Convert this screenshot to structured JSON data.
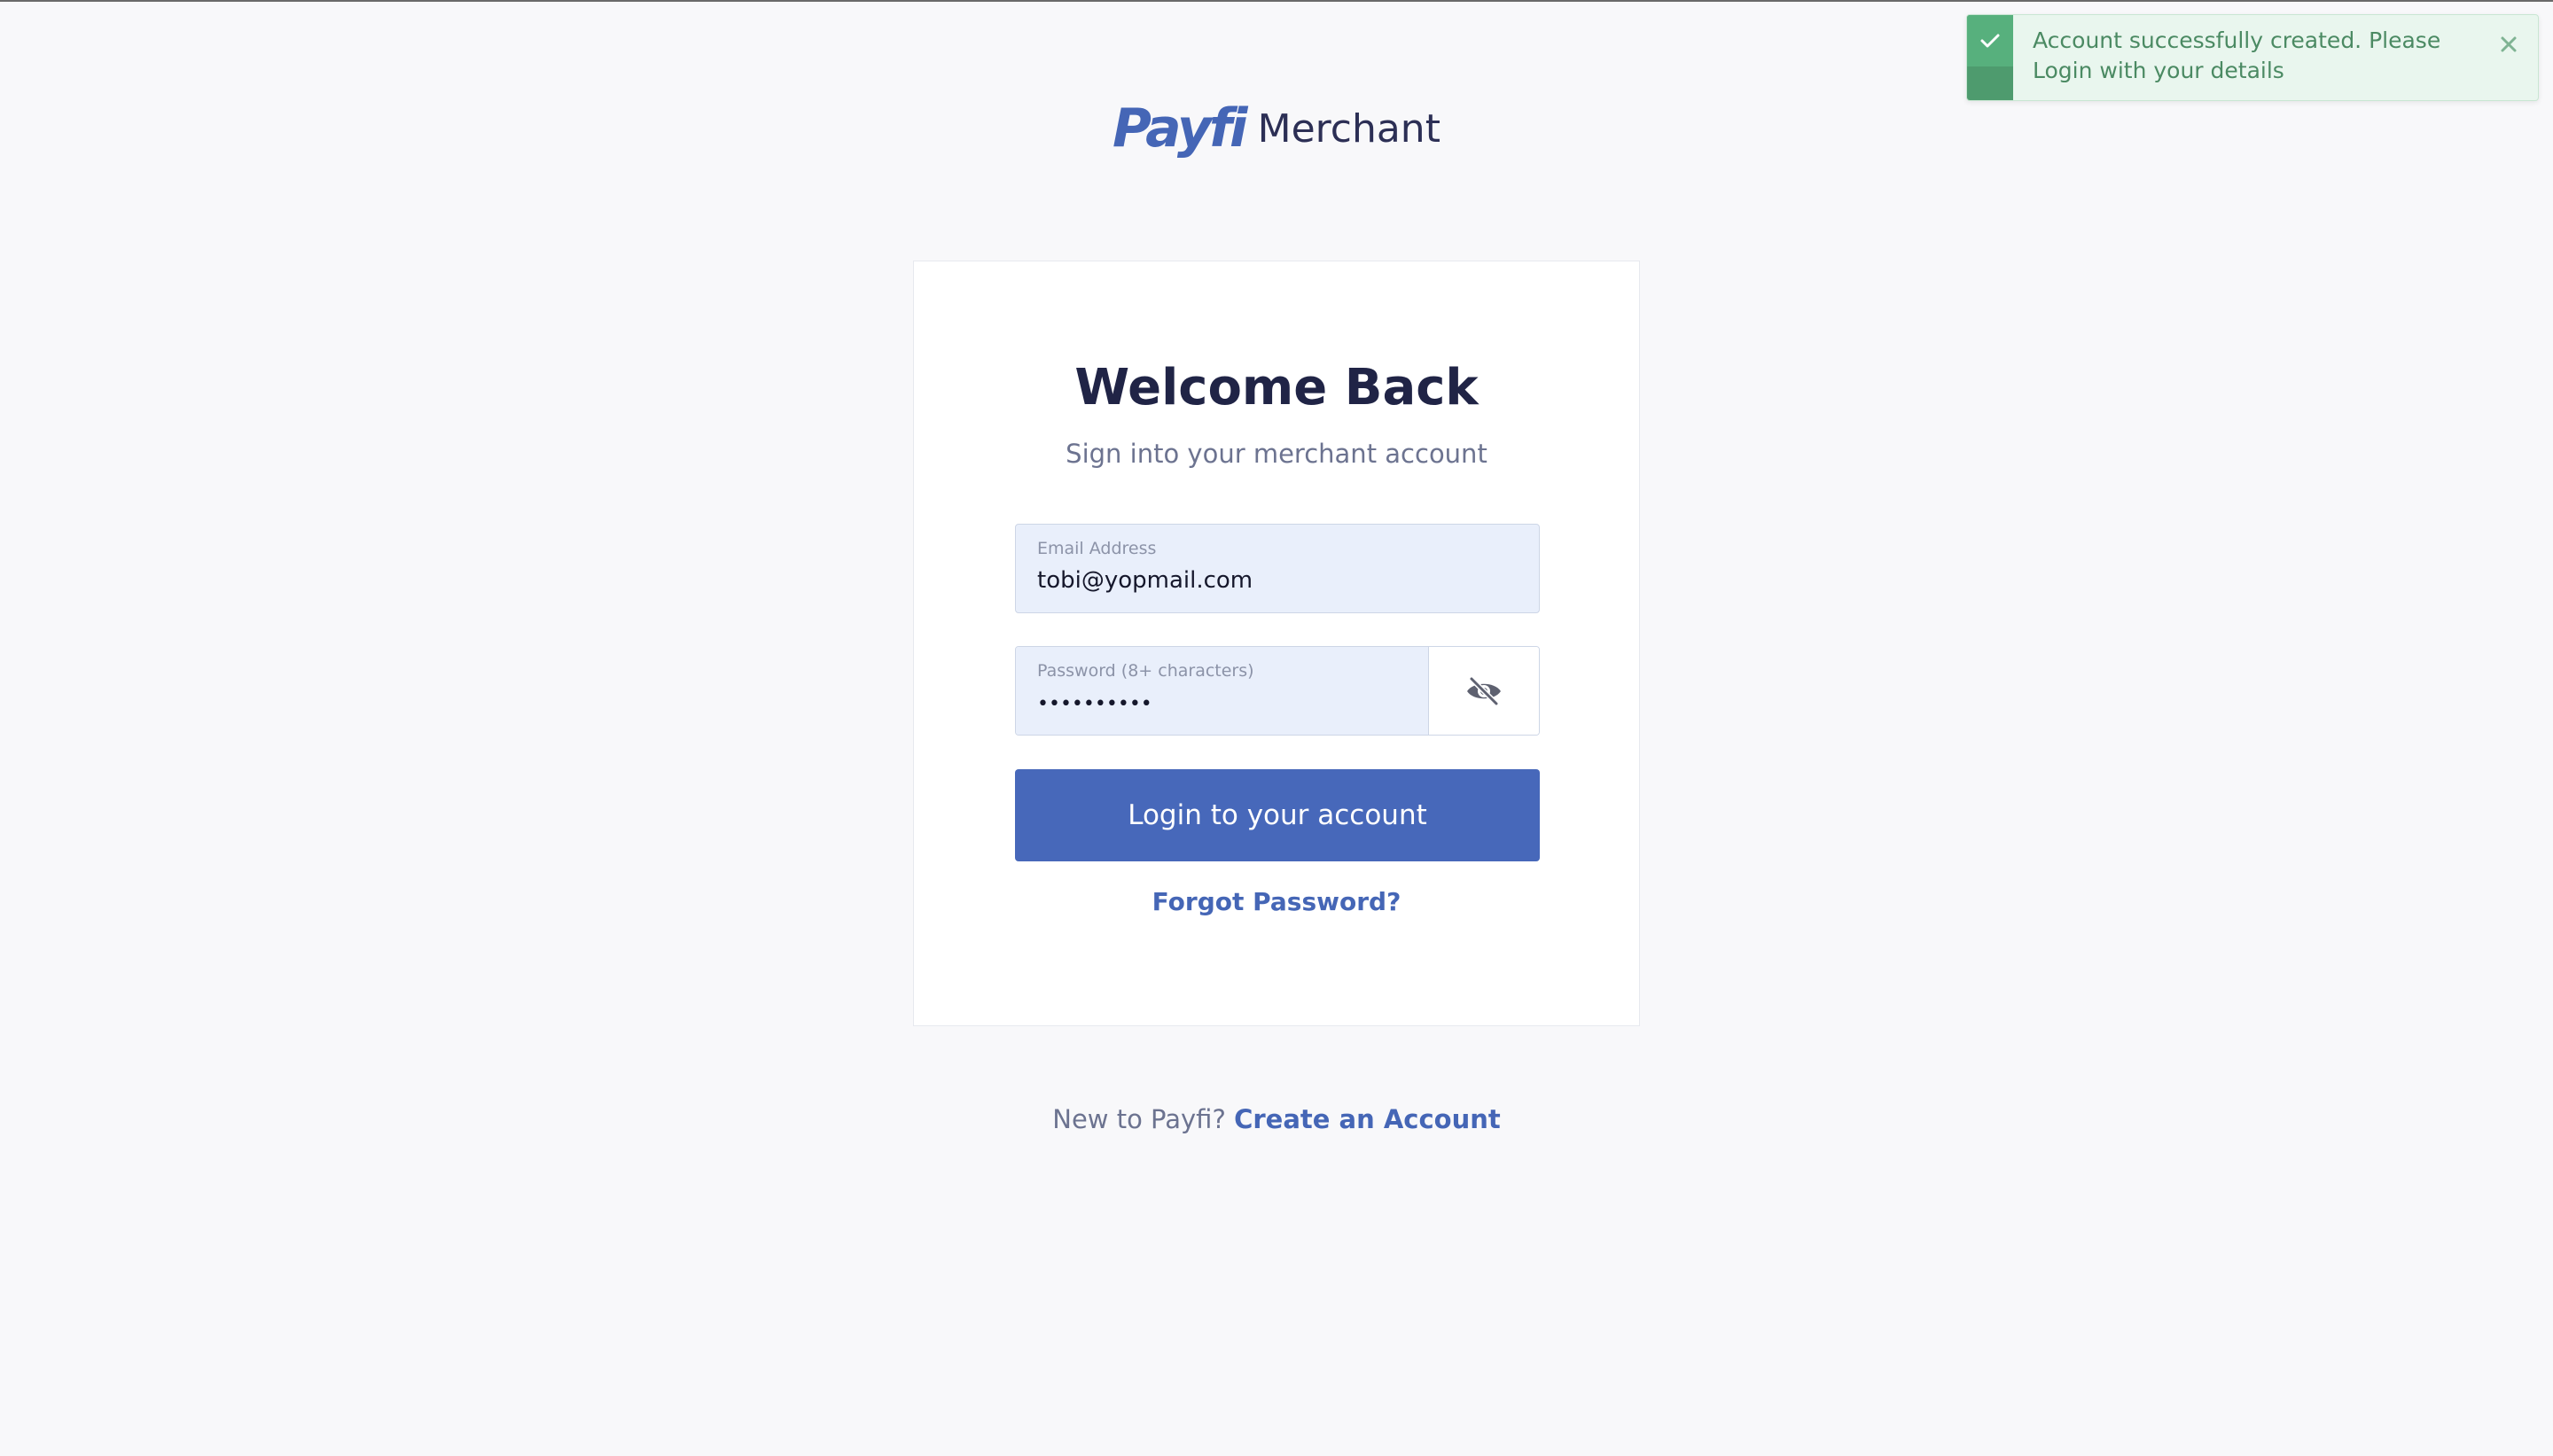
{
  "brand": {
    "logo_mark": "Payfi",
    "product": "Merchant",
    "color": "#4566b6"
  },
  "login": {
    "title": "Welcome Back",
    "subtitle": "Sign into your merchant account",
    "email": {
      "label": "Email Address",
      "value": "tobi@yopmail.com"
    },
    "password": {
      "label": "Password (8+ characters)",
      "value": "••••••••••",
      "toggle_icon": "eye-off-icon"
    },
    "submit_label": "Login to your account",
    "forgot_label": "Forgot Password?"
  },
  "signup": {
    "prompt": "New to Payfi?",
    "link_label": "Create an Account"
  },
  "toast": {
    "message": "Account successfully created. Please Login with your details",
    "status_icon": "check-icon",
    "close_icon": "close-icon",
    "color": "#57b07d"
  }
}
